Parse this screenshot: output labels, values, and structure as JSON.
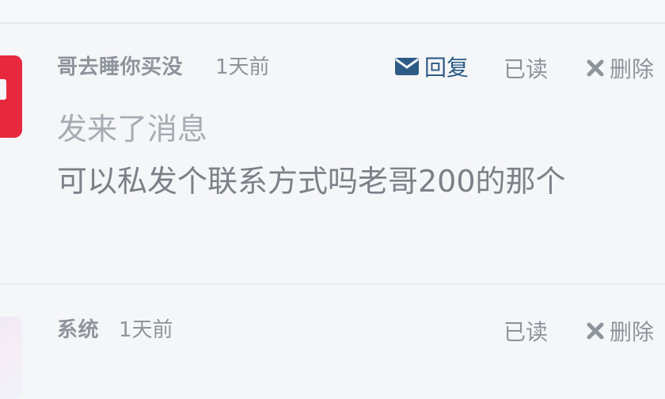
{
  "messages": [
    {
      "sender": "哥去睡你买没",
      "time": "1天前",
      "actions": {
        "reply": "回复",
        "read": "已读",
        "delete": "删除"
      },
      "subject": "发来了消息",
      "body": "可以私发个联系方式吗老哥200的那个"
    },
    {
      "sender": "系统",
      "time": "1天前",
      "actions": {
        "read": "已读",
        "delete": "删除"
      }
    }
  ],
  "colors": {
    "reply": "#2d5b86",
    "muted": "#8e949c",
    "body": "#7b8189",
    "avatar_red": "#e8283f"
  },
  "icons": {
    "reply": "envelope-icon",
    "delete": "close-x-icon"
  }
}
